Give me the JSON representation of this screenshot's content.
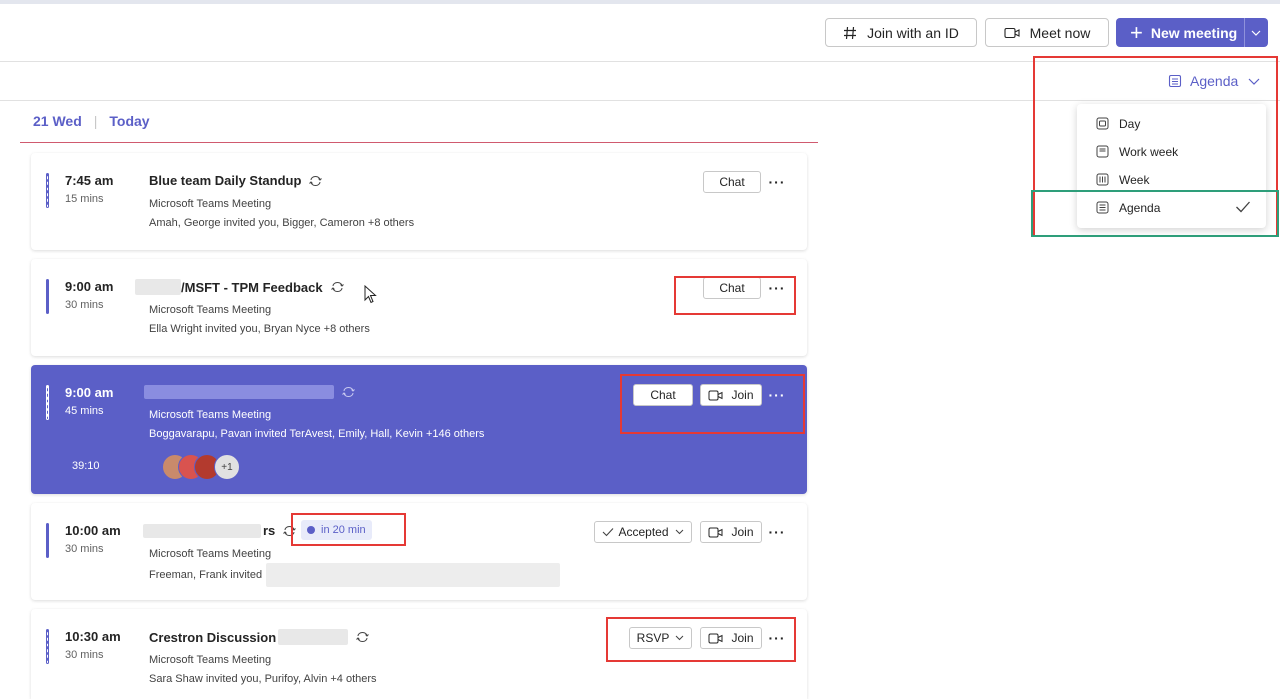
{
  "header": {
    "join_id_label": "Join with an ID",
    "meet_now_label": "Meet now",
    "new_meeting_label": "New meeting",
    "join_id_icon": "hash-icon",
    "meet_now_icon": "video-icon",
    "new_meeting_icon": "plus-icon"
  },
  "view_selector": {
    "current": "Agenda",
    "options": [
      {
        "label": "Day",
        "icon": "day-view-icon",
        "selected": false
      },
      {
        "label": "Work week",
        "icon": "work-week-view-icon",
        "selected": false
      },
      {
        "label": "Week",
        "icon": "week-view-icon",
        "selected": false
      },
      {
        "label": "Agenda",
        "icon": "agenda-view-icon",
        "selected": true
      }
    ]
  },
  "date_header": {
    "date": "21 Wed",
    "today": "Today"
  },
  "meetings": [
    {
      "time": "7:45 am",
      "duration": "15 mins",
      "title": "Blue team Daily Standup",
      "type": "Microsoft Teams Meeting",
      "attendees": "Amah, George invited you, Bigger, Cameron +8 others",
      "actions": [
        "Chat"
      ]
    },
    {
      "time": "9:00 am",
      "duration": "30 mins",
      "title": "/MSFT - TPM Feedback",
      "type": "Microsoft Teams Meeting",
      "attendees": "Ella Wright invited you, Bryan Nyce +8 others",
      "actions": [
        "Chat"
      ]
    },
    {
      "time": "9:00 am",
      "duration": "45 mins",
      "title": "",
      "type": "Microsoft Teams Meeting",
      "attendees": "Boggavarapu, Pavan invited TerAvest, Emily, Hall, Kevin +146 others",
      "elapsed": "39:10",
      "more_participants": "+1",
      "actions": [
        "Chat",
        "Join"
      ]
    },
    {
      "time": "10:00 am",
      "duration": "30 mins",
      "title": "rs",
      "starts_in": "in 20 min",
      "type": "Microsoft Teams Meeting",
      "attendees": "Freeman, Frank invited",
      "actions": [
        "Accepted",
        "Join"
      ]
    },
    {
      "time": "10:30 am",
      "duration": "30 mins",
      "title": "Crestron Discussion",
      "type": "Microsoft Teams Meeting",
      "attendees": "Sara Shaw invited you, Purifoy, Alvin +4 others",
      "actions": [
        "RSVP",
        "Join"
      ]
    }
  ],
  "colors": {
    "accent": "#5b5fc7",
    "annotation_red": "#e53935",
    "annotation_green": "#2e9e7a"
  }
}
